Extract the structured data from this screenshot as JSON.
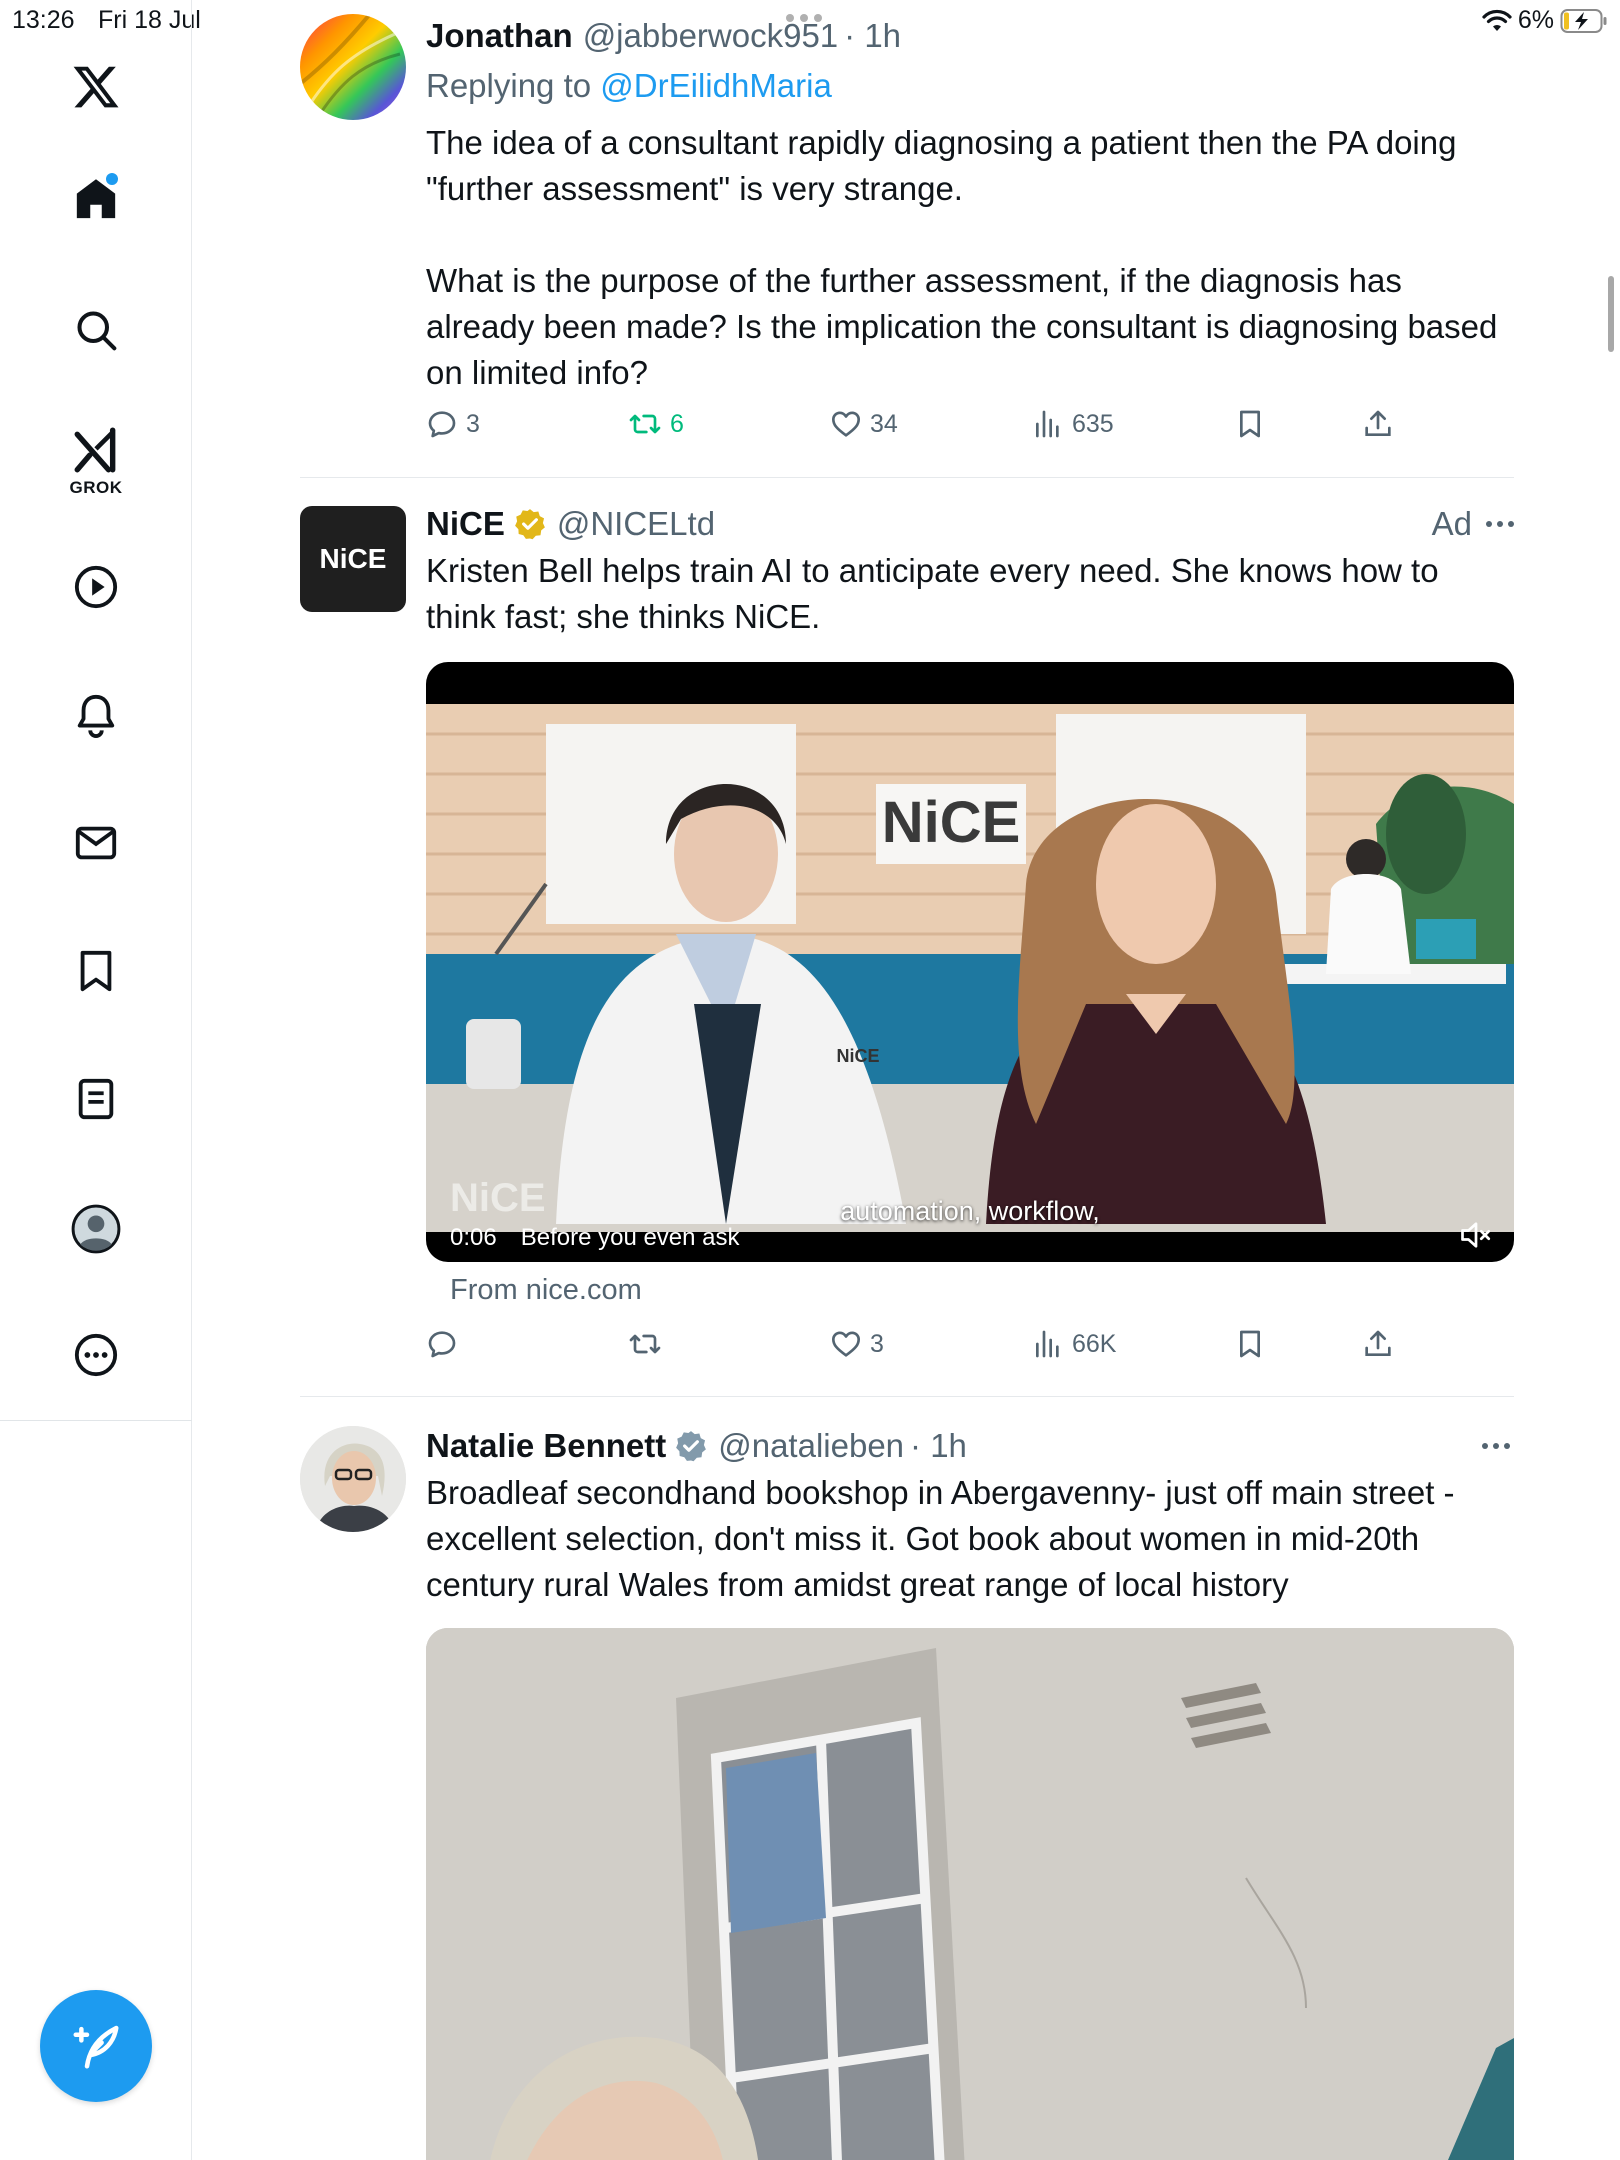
{
  "status_bar": {
    "time": "13:26",
    "date": "Fri 18 Jul",
    "battery": "6%"
  },
  "sidebar": {
    "grok_label": "GROK"
  },
  "tweets": [
    {
      "name": "Jonathan",
      "handle": "@jabberwock951",
      "time": "· 1h",
      "reply_prefix": "Replying to",
      "reply_mention": "@DrEilidhMaria",
      "text": "The idea of a consultant rapidly diagnosing a patient then the PA doing \"further assessment\" is very strange.\n\nWhat is the purpose of the further assessment, if the diagnosis has already been made? Is the implication the consultant is diagnosing based on limited info?",
      "replies": "3",
      "retweets": "6",
      "likes": "34",
      "views": "635"
    },
    {
      "name": "NiCE",
      "handle": "@NICELtd",
      "ad_label": "Ad",
      "text": "Kristen Bell helps train AI to anticipate every need. She knows how to think fast; she thinks NiCE.",
      "video": {
        "timestamp": "0:06",
        "title": "Before you even ask",
        "caption": "automation, workflow,",
        "wall_logo": "NiCE",
        "corner_logo": "NiCE",
        "coat_logo": "NiCE"
      },
      "from": "From nice.com",
      "likes": "3",
      "views": "66K",
      "avatar_text": "NiCE"
    },
    {
      "name": "Natalie Bennett",
      "handle": "@natalieben",
      "time": "· 1h",
      "text": "Broadleaf secondhand bookshop in Abergavenny- just off main street - excellent selection, don't miss it. Got book about women in mid-20th century rural Wales from amidst great range of local history"
    }
  ],
  "colors": {
    "accent": "#1d9bf0",
    "retweet_active": "#00ba7c",
    "muted": "#536471",
    "verified_gold": "#e2b719"
  }
}
